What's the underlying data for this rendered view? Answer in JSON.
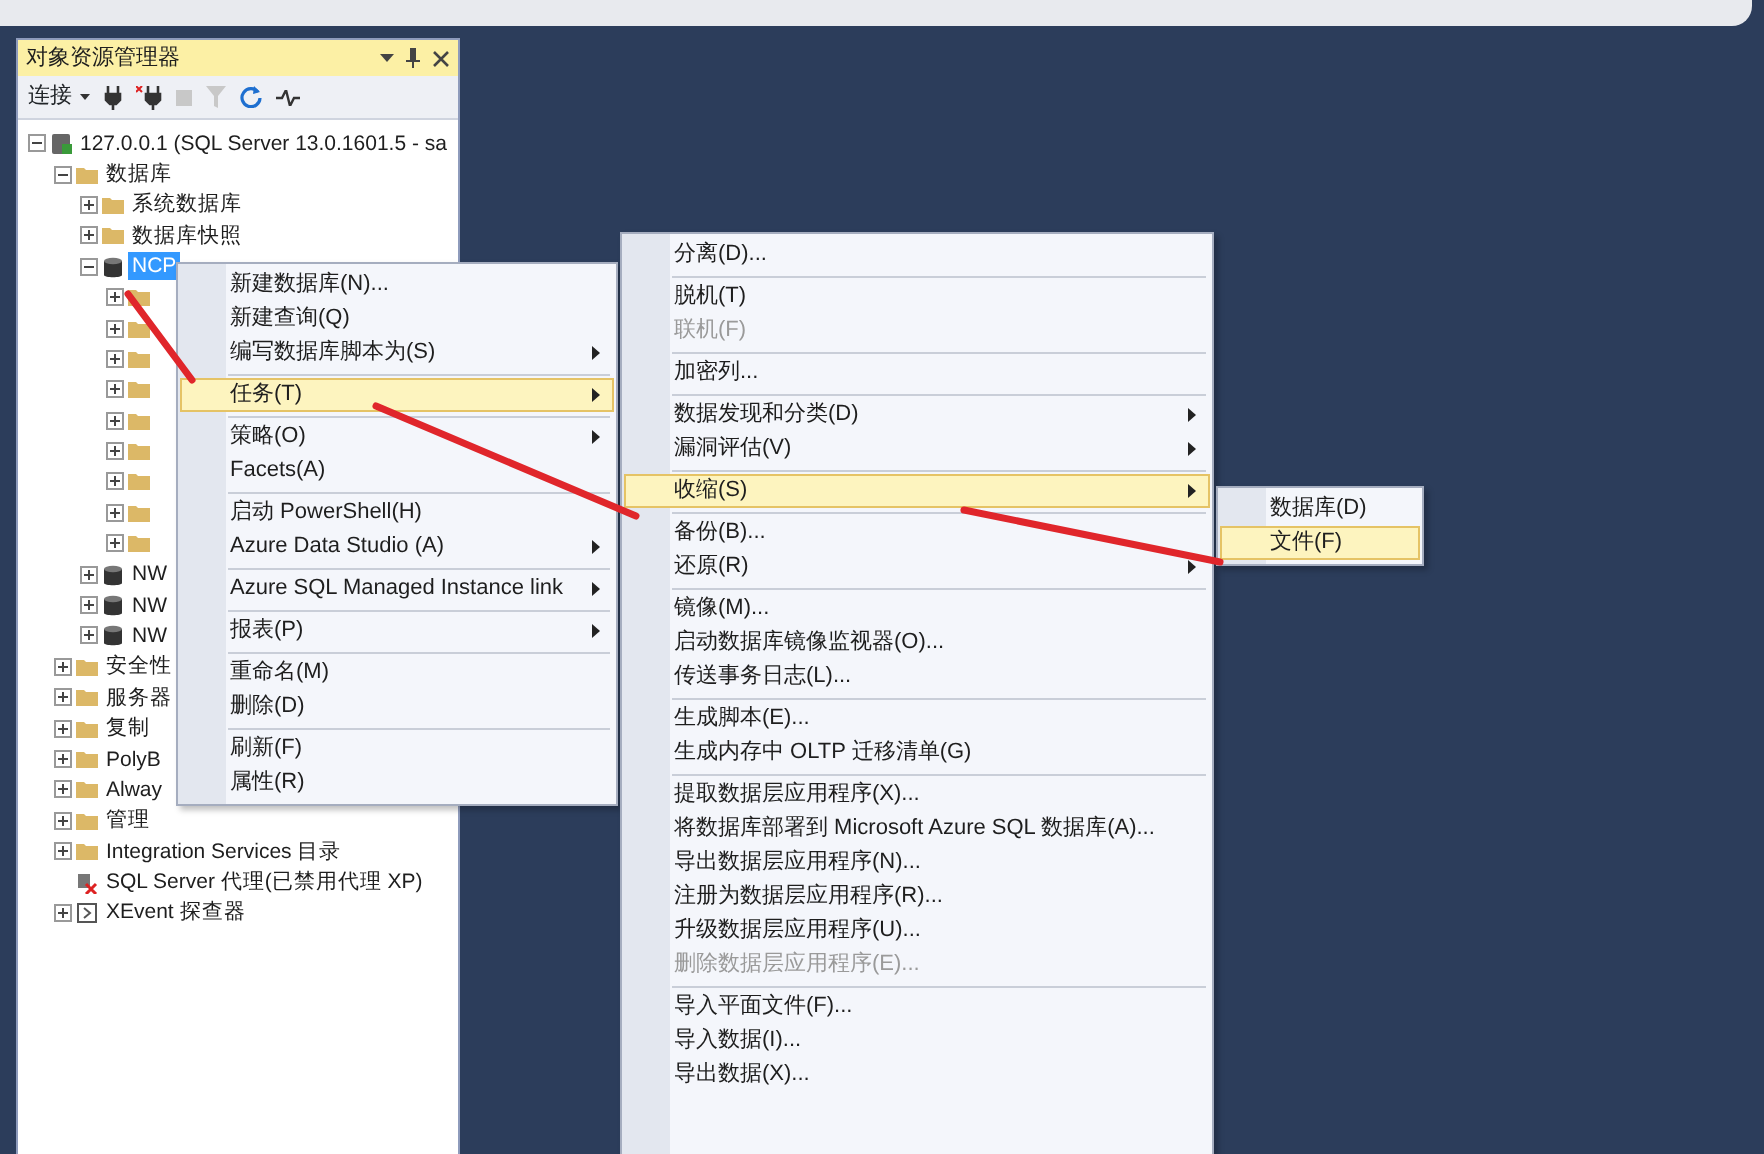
{
  "panel": {
    "title": "对象资源管理器",
    "connect_label": "连接"
  },
  "tree": [
    {
      "label": "127.0.0.1 (SQL Server 13.0.1601.5 - sa",
      "kind": "server",
      "expanded": true,
      "selected": false,
      "children": [
        {
          "label": "数据库",
          "kind": "folder",
          "expanded": true,
          "selected": false,
          "children": [
            {
              "label": "系统数据库",
              "kind": "folder",
              "expanded": false,
              "selected": false
            },
            {
              "label": "数据库快照",
              "kind": "folder",
              "expanded": false,
              "selected": false
            },
            {
              "label": "NCP",
              "kind": "database",
              "expanded": true,
              "selected": true,
              "children": [
                {
                  "kind": "folder",
                  "expanded": false
                },
                {
                  "kind": "folder",
                  "expanded": false
                },
                {
                  "kind": "folder",
                  "expanded": false
                },
                {
                  "kind": "folder",
                  "expanded": false
                },
                {
                  "kind": "folder",
                  "expanded": false
                },
                {
                  "kind": "folder",
                  "expanded": false
                },
                {
                  "kind": "folder",
                  "expanded": false
                },
                {
                  "kind": "folder",
                  "expanded": false
                },
                {
                  "kind": "folder",
                  "expanded": false
                }
              ]
            },
            {
              "label": "NW",
              "kind": "database",
              "expanded": false,
              "selected": false
            },
            {
              "label": "NW",
              "kind": "database",
              "expanded": false,
              "selected": false
            },
            {
              "label": "NW",
              "kind": "database",
              "expanded": false,
              "selected": false
            }
          ]
        },
        {
          "label": "安全性",
          "kind": "folder",
          "expanded": false,
          "selected": false
        },
        {
          "label": "服务器",
          "kind": "folder",
          "expanded": false,
          "selected": false
        },
        {
          "label": "复制",
          "kind": "folder",
          "expanded": false,
          "selected": false
        },
        {
          "label": "PolyB",
          "kind": "folder",
          "expanded": false,
          "selected": false
        },
        {
          "label": "Alway",
          "kind": "folder",
          "expanded": false,
          "selected": false
        },
        {
          "label": "管理",
          "kind": "folder",
          "expanded": false,
          "selected": false
        },
        {
          "label": "Integration Services 目录",
          "kind": "folder",
          "expanded": false,
          "selected": false
        },
        {
          "label": "SQL Server 代理(已禁用代理 XP)",
          "kind": "agent",
          "selected": false
        },
        {
          "label": "XEvent 探查器",
          "kind": "xevent",
          "expanded": false,
          "selected": false
        }
      ]
    }
  ],
  "context_menus": [
    {
      "items": [
        {
          "kind": "item",
          "label": "新建数据库(N)...",
          "submenu": false,
          "highlighted": false,
          "disabled": false
        },
        {
          "kind": "item",
          "label": "新建查询(Q)",
          "submenu": false,
          "highlighted": false,
          "disabled": false
        },
        {
          "kind": "item",
          "label": "编写数据库脚本为(S)",
          "submenu": true,
          "highlighted": false,
          "disabled": false
        },
        {
          "kind": "separator"
        },
        {
          "kind": "item",
          "label": "任务(T)",
          "submenu": true,
          "highlighted": true,
          "disabled": false
        },
        {
          "kind": "separator"
        },
        {
          "kind": "item",
          "label": "策略(O)",
          "submenu": true,
          "highlighted": false,
          "disabled": false
        },
        {
          "kind": "item",
          "label": "Facets(A)",
          "submenu": false,
          "highlighted": false,
          "disabled": false
        },
        {
          "kind": "separator"
        },
        {
          "kind": "item",
          "label": "启动 PowerShell(H)",
          "submenu": false,
          "highlighted": false,
          "disabled": false
        },
        {
          "kind": "item",
          "label": "Azure Data Studio (A)",
          "submenu": true,
          "highlighted": false,
          "disabled": false
        },
        {
          "kind": "separator"
        },
        {
          "kind": "item",
          "label": "Azure SQL Managed Instance link",
          "submenu": true,
          "highlighted": false,
          "disabled": false
        },
        {
          "kind": "separator"
        },
        {
          "kind": "item",
          "label": "报表(P)",
          "submenu": true,
          "highlighted": false,
          "disabled": false
        },
        {
          "kind": "separator"
        },
        {
          "kind": "item",
          "label": "重命名(M)",
          "submenu": false,
          "highlighted": false,
          "disabled": false
        },
        {
          "kind": "item",
          "label": "删除(D)",
          "submenu": false,
          "highlighted": false,
          "disabled": false
        },
        {
          "kind": "separator"
        },
        {
          "kind": "item",
          "label": "刷新(F)",
          "submenu": false,
          "highlighted": false,
          "disabled": false
        },
        {
          "kind": "item",
          "label": "属性(R)",
          "submenu": false,
          "highlighted": false,
          "disabled": false
        }
      ]
    },
    {
      "items": [
        {
          "kind": "item",
          "label": "分离(D)...",
          "submenu": false,
          "highlighted": false,
          "disabled": false
        },
        {
          "kind": "separator"
        },
        {
          "kind": "item",
          "label": "脱机(T)",
          "submenu": false,
          "highlighted": false,
          "disabled": false
        },
        {
          "kind": "item",
          "label": "联机(F)",
          "submenu": false,
          "highlighted": false,
          "disabled": true
        },
        {
          "kind": "separator"
        },
        {
          "kind": "item",
          "label": "加密列...",
          "submenu": false,
          "highlighted": false,
          "disabled": false
        },
        {
          "kind": "separator"
        },
        {
          "kind": "item",
          "label": "数据发现和分类(D)",
          "submenu": true,
          "highlighted": false,
          "disabled": false
        },
        {
          "kind": "item",
          "label": "漏洞评估(V)",
          "submenu": true,
          "highlighted": false,
          "disabled": false
        },
        {
          "kind": "separator"
        },
        {
          "kind": "item",
          "label": "收缩(S)",
          "submenu": true,
          "highlighted": true,
          "disabled": false
        },
        {
          "kind": "separator"
        },
        {
          "kind": "item",
          "label": "备份(B)...",
          "submenu": false,
          "highlighted": false,
          "disabled": false
        },
        {
          "kind": "item",
          "label": "还原(R)",
          "submenu": true,
          "highlighted": false,
          "disabled": false
        },
        {
          "kind": "separator"
        },
        {
          "kind": "item",
          "label": "镜像(M)...",
          "submenu": false,
          "highlighted": false,
          "disabled": false
        },
        {
          "kind": "item",
          "label": "启动数据库镜像监视器(O)...",
          "submenu": false,
          "highlighted": false,
          "disabled": false
        },
        {
          "kind": "item",
          "label": "传送事务日志(L)...",
          "submenu": false,
          "highlighted": false,
          "disabled": false
        },
        {
          "kind": "separator"
        },
        {
          "kind": "item",
          "label": "生成脚本(E)...",
          "submenu": false,
          "highlighted": false,
          "disabled": false
        },
        {
          "kind": "item",
          "label": "生成内存中 OLTP 迁移清单(G)",
          "submenu": false,
          "highlighted": false,
          "disabled": false
        },
        {
          "kind": "separator"
        },
        {
          "kind": "item",
          "label": "提取数据层应用程序(X)...",
          "submenu": false,
          "highlighted": false,
          "disabled": false
        },
        {
          "kind": "item",
          "label": "将数据库部署到 Microsoft Azure SQL 数据库(A)...",
          "submenu": false,
          "highlighted": false,
          "disabled": false
        },
        {
          "kind": "item",
          "label": "导出数据层应用程序(N)...",
          "submenu": false,
          "highlighted": false,
          "disabled": false
        },
        {
          "kind": "item",
          "label": "注册为数据层应用程序(R)...",
          "submenu": false,
          "highlighted": false,
          "disabled": false
        },
        {
          "kind": "item",
          "label": "升级数据层应用程序(U)...",
          "submenu": false,
          "highlighted": false,
          "disabled": false
        },
        {
          "kind": "item",
          "label": "删除数据层应用程序(E)...",
          "submenu": false,
          "highlighted": false,
          "disabled": true
        },
        {
          "kind": "separator"
        },
        {
          "kind": "item",
          "label": "导入平面文件(F)...",
          "submenu": false,
          "highlighted": false,
          "disabled": false
        },
        {
          "kind": "item",
          "label": "导入数据(I)...",
          "submenu": false,
          "highlighted": false,
          "disabled": false
        },
        {
          "kind": "item",
          "label": "导出数据(X)...",
          "submenu": false,
          "highlighted": false,
          "disabled": false
        }
      ]
    },
    {
      "items": [
        {
          "kind": "item",
          "label": "数据库(D)",
          "submenu": false,
          "highlighted": false,
          "disabled": false
        },
        {
          "kind": "item",
          "label": "文件(F)",
          "submenu": false,
          "highlighted": true,
          "disabled": false
        }
      ]
    }
  ]
}
